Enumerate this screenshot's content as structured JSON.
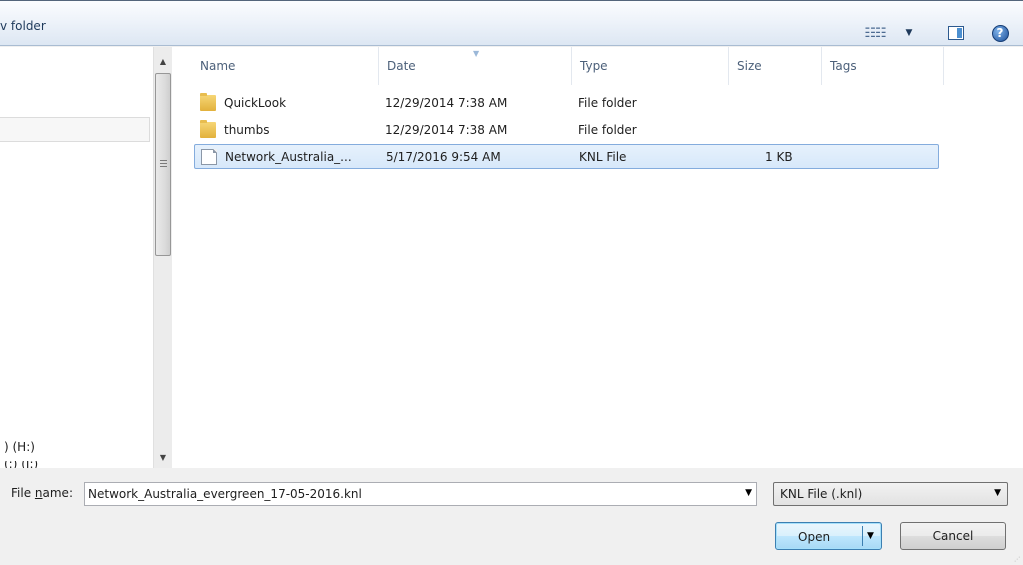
{
  "toolbar": {
    "command": "v folder",
    "views_icon": "views-icon",
    "views_arrow": "▼",
    "preview_icon": "preview-pane-icon",
    "help_icon": "help-icon",
    "help_glyph": "?"
  },
  "nav": {
    "drive_label": ") (H:)",
    "partial_label": "(:) (I:)"
  },
  "scrollbar": {
    "up": "▲",
    "down": "▼"
  },
  "columns": {
    "name": "Name",
    "date": "Date",
    "type": "Type",
    "size": "Size",
    "tags": "Tags",
    "sort_indicator": "▼"
  },
  "files": [
    {
      "name": "QuickLook",
      "date": "12/29/2014 7:38 AM",
      "type": "File folder",
      "size": "",
      "icon": "folder-icon"
    },
    {
      "name": "thumbs",
      "date": "12/29/2014 7:38 AM",
      "type": "File folder",
      "size": "",
      "icon": "folder-icon"
    },
    {
      "name": "Network_Australia_...",
      "date": "5/17/2016 9:54 AM",
      "type": "KNL File",
      "size": "1 KB",
      "icon": "file-icon"
    }
  ],
  "bottom": {
    "filename_label_pre": "File ",
    "filename_label_ul": "n",
    "filename_label_post": "ame:",
    "filename_value": "Network_Australia_evergreen_17-05-2016.knl",
    "filename_arrow": "▼",
    "filetype_value": "KNL File (.knl)",
    "filetype_arrow": "▼",
    "open_label": "Open",
    "open_arrow": "▼",
    "cancel_label": "Cancel"
  },
  "colors": {
    "selection_fill": "#d7e8fa",
    "selection_border": "#84acdd",
    "toolbar_text": "#1e395b"
  }
}
